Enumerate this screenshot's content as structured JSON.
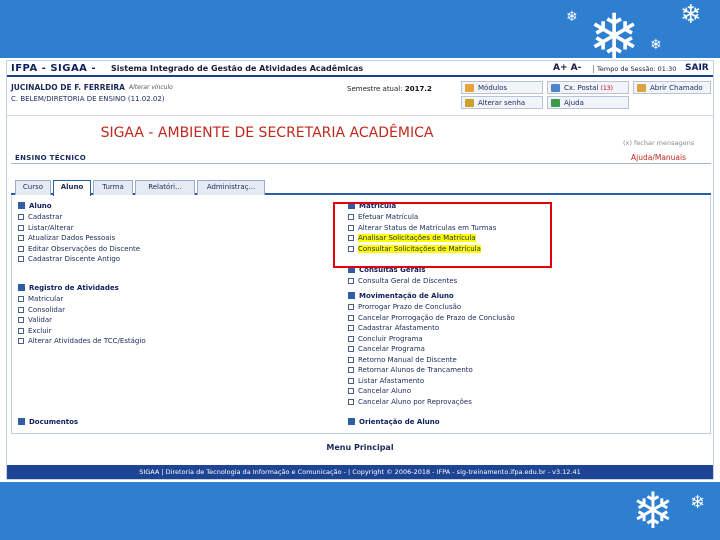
{
  "slide": {
    "accent_color": "#2e7fd0",
    "decoration": "snowflake-icon"
  },
  "sysbar": {
    "brand": "IFPA - SIGAA -",
    "system_name": "Sistema Integrado de Gestão de Atividades Acadêmicas",
    "font_controls": "A+ A-",
    "session": "Tempo de Sessão: 01:30",
    "logout": "SAIR"
  },
  "info": {
    "user": "JUCINALDO DE F. FERREIRA",
    "user_link": "Alterar vínculo",
    "unit": "C. BELEM/DIRETORIA DE ENSINO (11.02.02)",
    "semester_label": "Semestre atual:",
    "semester_value": "2017.2"
  },
  "quick_buttons": [
    {
      "label": "Módulos",
      "badge": "",
      "icon": "modules-icon",
      "color": "#e8a33c"
    },
    {
      "label": "Cx. Postal",
      "badge": "(13)",
      "icon": "mailbox-icon",
      "color": "#4a86c8"
    },
    {
      "label": "Abrir Chamado",
      "badge": "",
      "icon": "ticket-icon",
      "color": "#d9a441"
    },
    {
      "label": "Alterar senha",
      "badge": "",
      "icon": "key-icon",
      "color": "#c9a227"
    },
    {
      "label": "Ajuda",
      "badge": "",
      "icon": "help-icon",
      "color": "#3d9a4a"
    }
  ],
  "page": {
    "title": "SIGAA - AMBIENTE DE SECRETARIA ACADÊMICA",
    "hide_messages": "(x) fechar mensagens",
    "level": "ENSINO TÉCNICO",
    "help_link": "Ajuda/Manuais",
    "title_color": "#c0281e"
  },
  "tabs": [
    {
      "label": "Curso"
    },
    {
      "label": "Aluno"
    },
    {
      "label": "Turma"
    },
    {
      "label": "Relatóri..."
    },
    {
      "label": "Administraç..."
    }
  ],
  "groups": {
    "aluno": {
      "title": "Aluno",
      "items": [
        "Cadastrar",
        "Listar/Alterar",
        "Atualizar Dados Pessoais",
        "Editar Observações do Discente",
        "Cadastrar Discente Antigo"
      ]
    },
    "registro": {
      "title": "Registro de Atividades",
      "items": [
        "Matricular",
        "Consolidar",
        "Validar",
        "Excluir",
        "Alterar Atividades de TCC/Estágio"
      ]
    },
    "documentos": {
      "title": "Documentos"
    },
    "matricula": {
      "title": "Matrícula",
      "items": [
        "Efetuar Matrícula",
        "Alterar Status de Matrículas em Turmas",
        "Analisar Solicitações de Matrícula",
        "Consultar Solicitações de Matrícula"
      ]
    },
    "consultas": {
      "title": "Consultas Gerais",
      "items": [
        "Consulta Geral de Discentes"
      ]
    },
    "movimentacao": {
      "title": "Movimentação de Aluno",
      "items": [
        "Prorrogar Prazo de Conclusão",
        "Cancelar Prorrogação de Prazo de Conclusão",
        "Cadastrar Afastamento",
        "Concluir Programa",
        "Cancelar Programa",
        "Retorno Manual de Discente",
        "Retornar Alunos de Trancamento",
        "Listar Afastamento",
        "Cancelar Aluno",
        "Cancelar Aluno por Reprovações"
      ]
    },
    "orientacao": {
      "title": "Orientação de Aluno"
    }
  },
  "menu_principal": "Menu Principal",
  "footer": "SIGAA | Diretoria de Tecnologia da Informação e Comunicação - | Copyright © 2006-2018 - IFPA - sig-treinamento.ifpa.edu.br - v3.12.41",
  "highlight_color": "#e3000b"
}
